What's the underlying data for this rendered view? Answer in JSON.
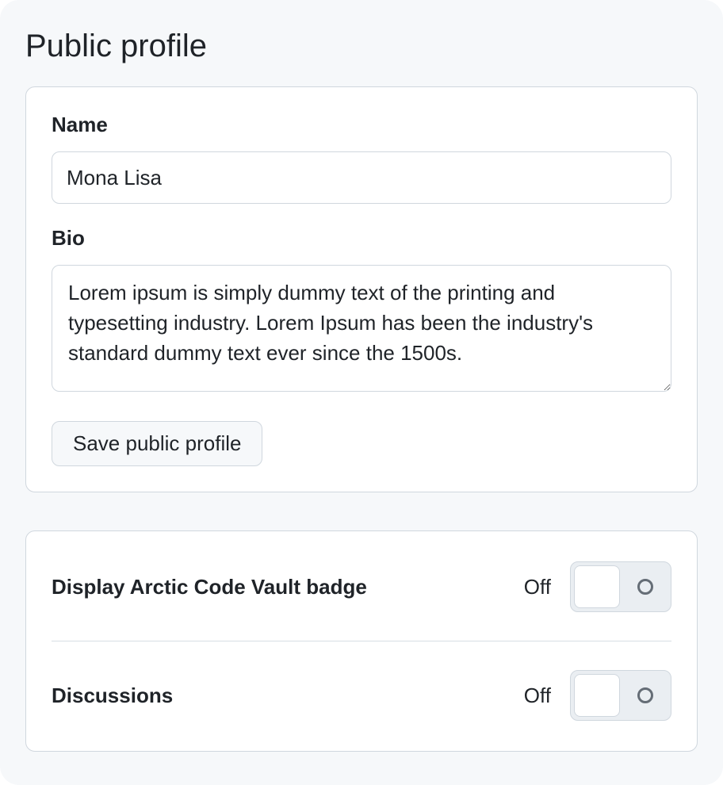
{
  "header": {
    "title": "Public profile"
  },
  "profile_form": {
    "name": {
      "label": "Name",
      "value": "Mona Lisa"
    },
    "bio": {
      "label": "Bio",
      "value": "Lorem ipsum is simply dummy text of the printing and typesetting industry. Lorem Ipsum has been the industry's standard dummy text ever since the 1500s."
    },
    "save_button_label": "Save public profile"
  },
  "toggles": {
    "arctic_badge": {
      "label": "Display Arctic Code Vault badge",
      "status": "Off",
      "on": false
    },
    "discussions": {
      "label": "Discussions",
      "status": "Off",
      "on": false
    }
  }
}
